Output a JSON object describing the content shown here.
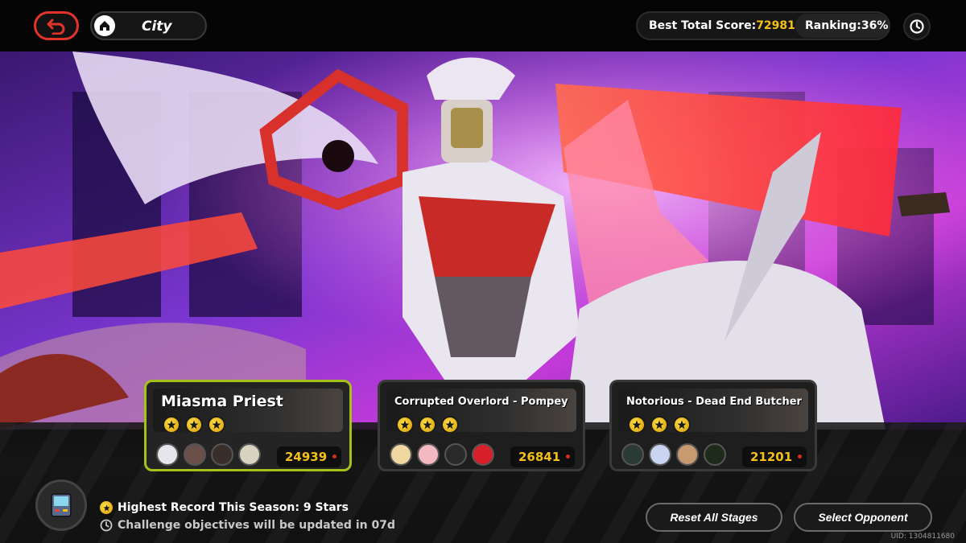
{
  "header": {
    "location": "City",
    "best_total_score_label": "Best Total Score:",
    "best_total_score_value": "72981",
    "ranking_label": "Ranking:36%"
  },
  "stages": [
    {
      "name": "Miasma Priest",
      "stars": 3,
      "score": "24939",
      "selected": true
    },
    {
      "name": "Corrupted Overlord - Pompey",
      "stars": 3,
      "score": "26841",
      "selected": false
    },
    {
      "name": "Notorious - Dead End Butcher",
      "stars": 3,
      "score": "21201",
      "selected": false
    }
  ],
  "footer": {
    "record": "Highest Record This Season: 9 Stars",
    "update_note": "Challenge objectives will be updated in  07d",
    "reset_label": "Reset All Stages",
    "select_label": "Select Opponent",
    "uid": "UID: 1304811680"
  },
  "colors": {
    "accent_red": "#e3342b",
    "score_gold": "#f4c018",
    "selected_border": "#a5c21a",
    "bg_purple": "#6a2fc0"
  },
  "icons": [
    "back-icon",
    "home-icon",
    "timer-icon",
    "star-coin-icon",
    "clock-icon",
    "device-icon"
  ]
}
